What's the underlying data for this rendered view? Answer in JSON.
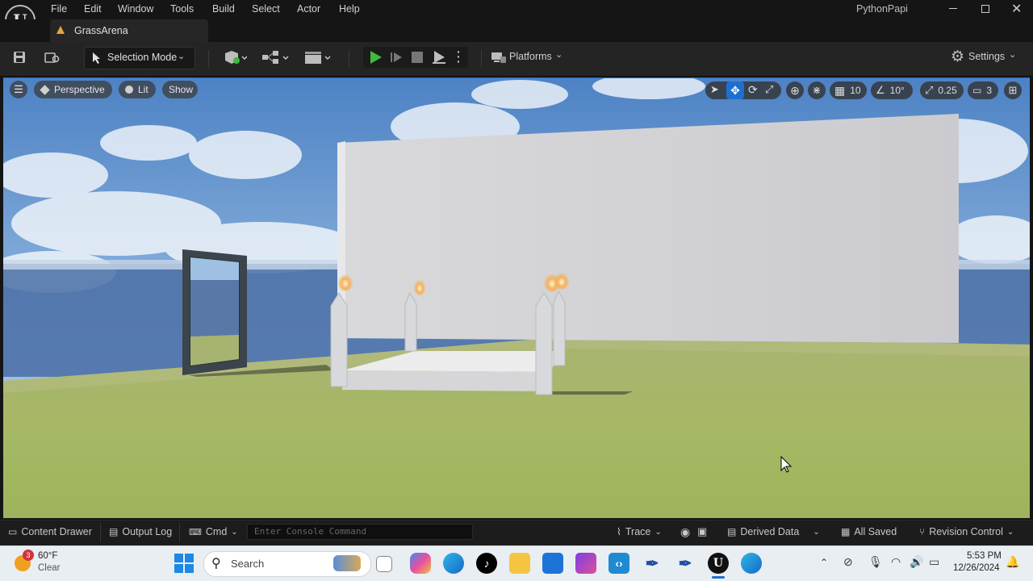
{
  "menu": [
    "File",
    "Edit",
    "Window",
    "Tools",
    "Build",
    "Select",
    "Actor",
    "Help"
  ],
  "window_user": "PythonPapi",
  "level_tab": "GrassArena",
  "toolbar": {
    "mode_label": "Selection Mode",
    "platforms_label": "Platforms",
    "settings_label": "Settings"
  },
  "viewport": {
    "perspective_label": "Perspective",
    "lit_label": "Lit",
    "show_label": "Show",
    "grid_snap": "10",
    "rotation_snap": "10°",
    "scale_snap": "0.25",
    "camera_speed": "3"
  },
  "bottom_bar": {
    "content_drawer": "Content Drawer",
    "output_log": "Output Log",
    "cmd": "Cmd",
    "console_placeholder": "Enter Console Command",
    "trace": "Trace",
    "derived_data": "Derived Data",
    "all_saved": "All Saved",
    "revision_control": "Revision Control"
  },
  "taskbar": {
    "weather_temp": "60°F",
    "weather_desc": "Clear",
    "weather_badge": "3",
    "search_placeholder": "Search",
    "time": "5:53 PM",
    "date": "12/26/2024"
  },
  "colors": {
    "accent_blue": "#1f6fd1",
    "play_green": "#3fb93f",
    "weather_badge": "#d13438"
  }
}
